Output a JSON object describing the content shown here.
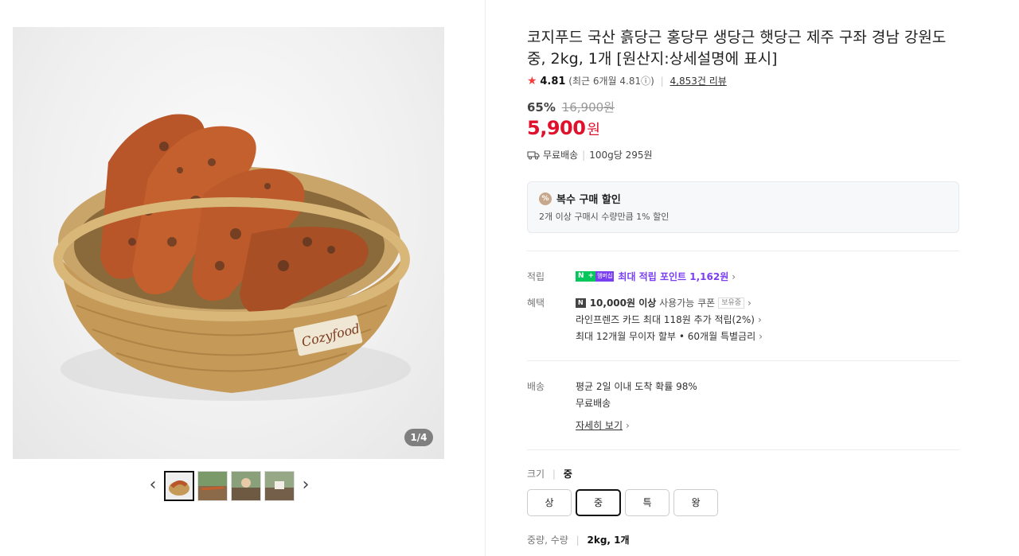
{
  "gallery": {
    "counter": "1/4",
    "image_label": "Cozyfood",
    "prev_icon": "chevron-left-icon",
    "next_icon": "chevron-right-icon",
    "prev_glyph": "‹",
    "next_glyph": "›",
    "thumbnails": [
      "thumb-1",
      "thumb-2",
      "thumb-3",
      "thumb-4"
    ]
  },
  "product": {
    "title": "코지푸드 국산 흙당근 홍당무 생당근 햇당근 제주 구좌 경남 강원도 중, 2kg, 1개 [원산지:상세설명에 표시]",
    "rating": {
      "star": "★",
      "score": "4.81",
      "recent": "(최근 6개월 4.81ⓘ)",
      "sep": "|",
      "reviews": "4,853건 리뷰"
    },
    "discount_pct": "65%",
    "original_price": "16,900원",
    "price": "5,900",
    "currency": "원",
    "shipping": {
      "free": "무료배송",
      "sep": "|",
      "unit_price": "100g당 295원"
    }
  },
  "promo": {
    "badge": "%",
    "title": "복수 구매 할인",
    "desc": "2개 이상 구매시 수량만큼 1% 할인"
  },
  "points": {
    "label": "적립",
    "n": "N",
    "plus": "+",
    "membership": "멤버십",
    "text": "최대 적립 포인트 1,162원",
    "chevron": "›"
  },
  "benefits": {
    "label": "혜택",
    "coupon_badge": "N",
    "coupon_bold": "10,000원 이상",
    "coupon_text": "사용가능 쿠폰",
    "coupon_chip": "보유중",
    "card": "라인프렌즈 카드 최대 118원 추가 적립(2%)",
    "installment": "최대 12개월 무이자 할부 • 60개월 특별금리",
    "chevron": "›"
  },
  "delivery": {
    "label": "배송",
    "probability": "평균 2일 이내 도착 확률 98%",
    "free": "무료배송",
    "more": "자세히 보기",
    "chevron": "›"
  },
  "size": {
    "label": "크기",
    "sep": "|",
    "selected": "중",
    "options": [
      "상",
      "중",
      "특",
      "왕"
    ]
  },
  "weight": {
    "label": "중량, 수량",
    "sep": "|",
    "value": "2kg, 1개"
  },
  "colors": {
    "price_red": "#e0112b",
    "npay_green": "#03c75a",
    "point_purple": "#7b3ff2"
  }
}
